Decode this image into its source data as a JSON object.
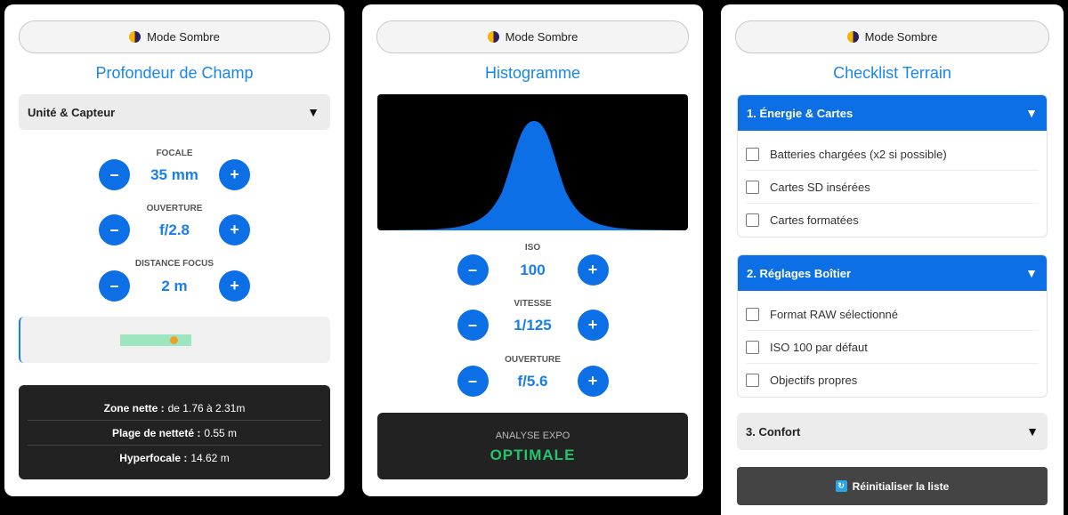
{
  "mode_button_label": "Mode Sombre",
  "dof_panel": {
    "title": "Profondeur de Champ",
    "accordion_label": "Unité & Capteur",
    "steppers": [
      {
        "label": "FOCALE",
        "value": "35 mm"
      },
      {
        "label": "OUVERTURE",
        "value": "f/2.8"
      },
      {
        "label": "DISTANCE FOCUS",
        "value": "2 m"
      }
    ],
    "results": [
      {
        "label": "Zone nette :",
        "value": "de 1.76 à 2.31m"
      },
      {
        "label": "Plage de netteté :",
        "value": "0.55 m"
      },
      {
        "label": "Hyperfocale :",
        "value": "14.62 m"
      }
    ]
  },
  "histogram_panel": {
    "title": "Histogramme",
    "steppers": [
      {
        "label": "ISO",
        "value": "100"
      },
      {
        "label": "VITESSE",
        "value": "1/125"
      },
      {
        "label": "OUVERTURE",
        "value": "f/5.6"
      }
    ],
    "analysis_label": "ANALYSE EXPO",
    "analysis_value": "OPTIMALE"
  },
  "checklist_panel": {
    "title": "Checklist Terrain",
    "sections": [
      {
        "title": "1. Énergie & Cartes",
        "expanded": true,
        "items": [
          "Batteries chargées (x2 si possible)",
          "Cartes SD insérées",
          "Cartes formatées"
        ]
      },
      {
        "title": "2. Réglages Boîtier",
        "expanded": true,
        "items": [
          "Format RAW sélectionné",
          "ISO 100 par défaut",
          "Objectifs propres"
        ]
      },
      {
        "title": "3. Confort",
        "expanded": false,
        "items": []
      }
    ],
    "reset_label": "Réinitialiser la liste"
  },
  "colors": {
    "accent": "#0d6fe6",
    "title": "#1a86e8",
    "success": "#22c46c",
    "dark_panel": "#222222"
  },
  "icons": {
    "mode": "half-moon-icon",
    "expanded": "caret-down-icon",
    "reset": "refresh-icon",
    "minus": "minus-icon",
    "plus": "plus-icon"
  }
}
